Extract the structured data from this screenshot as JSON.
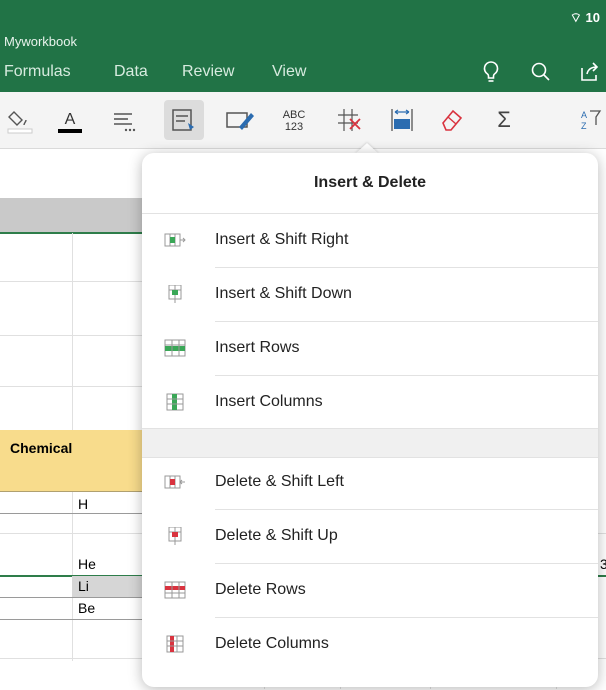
{
  "window": {
    "title": "Myworkbook",
    "status_icon": "wifi-icon",
    "battery_text": "10"
  },
  "menu": {
    "tabs": [
      "Formulas",
      "Data",
      "Review",
      "View"
    ]
  },
  "header_icons": [
    "lightbulb-icon",
    "search-icon",
    "share-icon"
  ],
  "toolbar": {
    "font_color_label": "A",
    "abc_top": "ABC",
    "abc_bottom": "123",
    "sum_label": "Σ",
    "sort_label_a": "A",
    "sort_label_z": "Z"
  },
  "sheet": {
    "header_cell": "Chemical",
    "rows": [
      "H",
      "",
      "He",
      "Li",
      "Be"
    ],
    "edge_digit": "3"
  },
  "popover": {
    "title": "Insert & Delete",
    "insert_items": [
      {
        "label": "Insert & Shift Right",
        "icon": "insert-shift-right-icon"
      },
      {
        "label": "Insert & Shift Down",
        "icon": "insert-shift-down-icon"
      },
      {
        "label": "Insert Rows",
        "icon": "insert-rows-icon"
      },
      {
        "label": "Insert Columns",
        "icon": "insert-columns-icon"
      }
    ],
    "delete_items": [
      {
        "label": "Delete & Shift Left",
        "icon": "delete-shift-left-icon"
      },
      {
        "label": "Delete & Shift Up",
        "icon": "delete-shift-up-icon"
      },
      {
        "label": "Delete Rows",
        "icon": "delete-rows-icon"
      },
      {
        "label": "Delete Columns",
        "icon": "delete-columns-icon"
      }
    ]
  },
  "colors": {
    "excel_green": "#217346",
    "insert_green": "#3aa757",
    "delete_red": "#d9333f",
    "header_yellow": "#f8dc8c"
  }
}
